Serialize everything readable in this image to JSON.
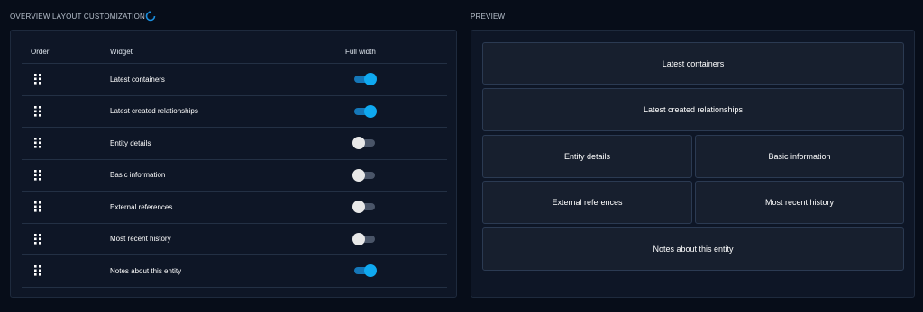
{
  "left": {
    "title": "OVERVIEW LAYOUT CUSTOMIZATION",
    "headers": {
      "order": "Order",
      "widget": "Widget",
      "full_width": "Full width"
    },
    "rows": [
      {
        "label": "Latest containers",
        "full_width": true
      },
      {
        "label": "Latest created relationships",
        "full_width": true
      },
      {
        "label": "Entity details",
        "full_width": false
      },
      {
        "label": "Basic information",
        "full_width": false
      },
      {
        "label": "External references",
        "full_width": false
      },
      {
        "label": "Most recent history",
        "full_width": false
      },
      {
        "label": "Notes about this entity",
        "full_width": true
      }
    ]
  },
  "right": {
    "title": "PREVIEW",
    "cards": [
      "Latest containers",
      "Latest created relationships",
      "Entity details",
      "Basic information",
      "External references",
      "Most recent history",
      "Notes about this entity"
    ]
  },
  "colors": {
    "background": "#070d19",
    "panel": "#0e1626",
    "card": "#171f2e",
    "toggle_on": "#0fa9f0",
    "refresh_icon": "#1a8fe0"
  }
}
